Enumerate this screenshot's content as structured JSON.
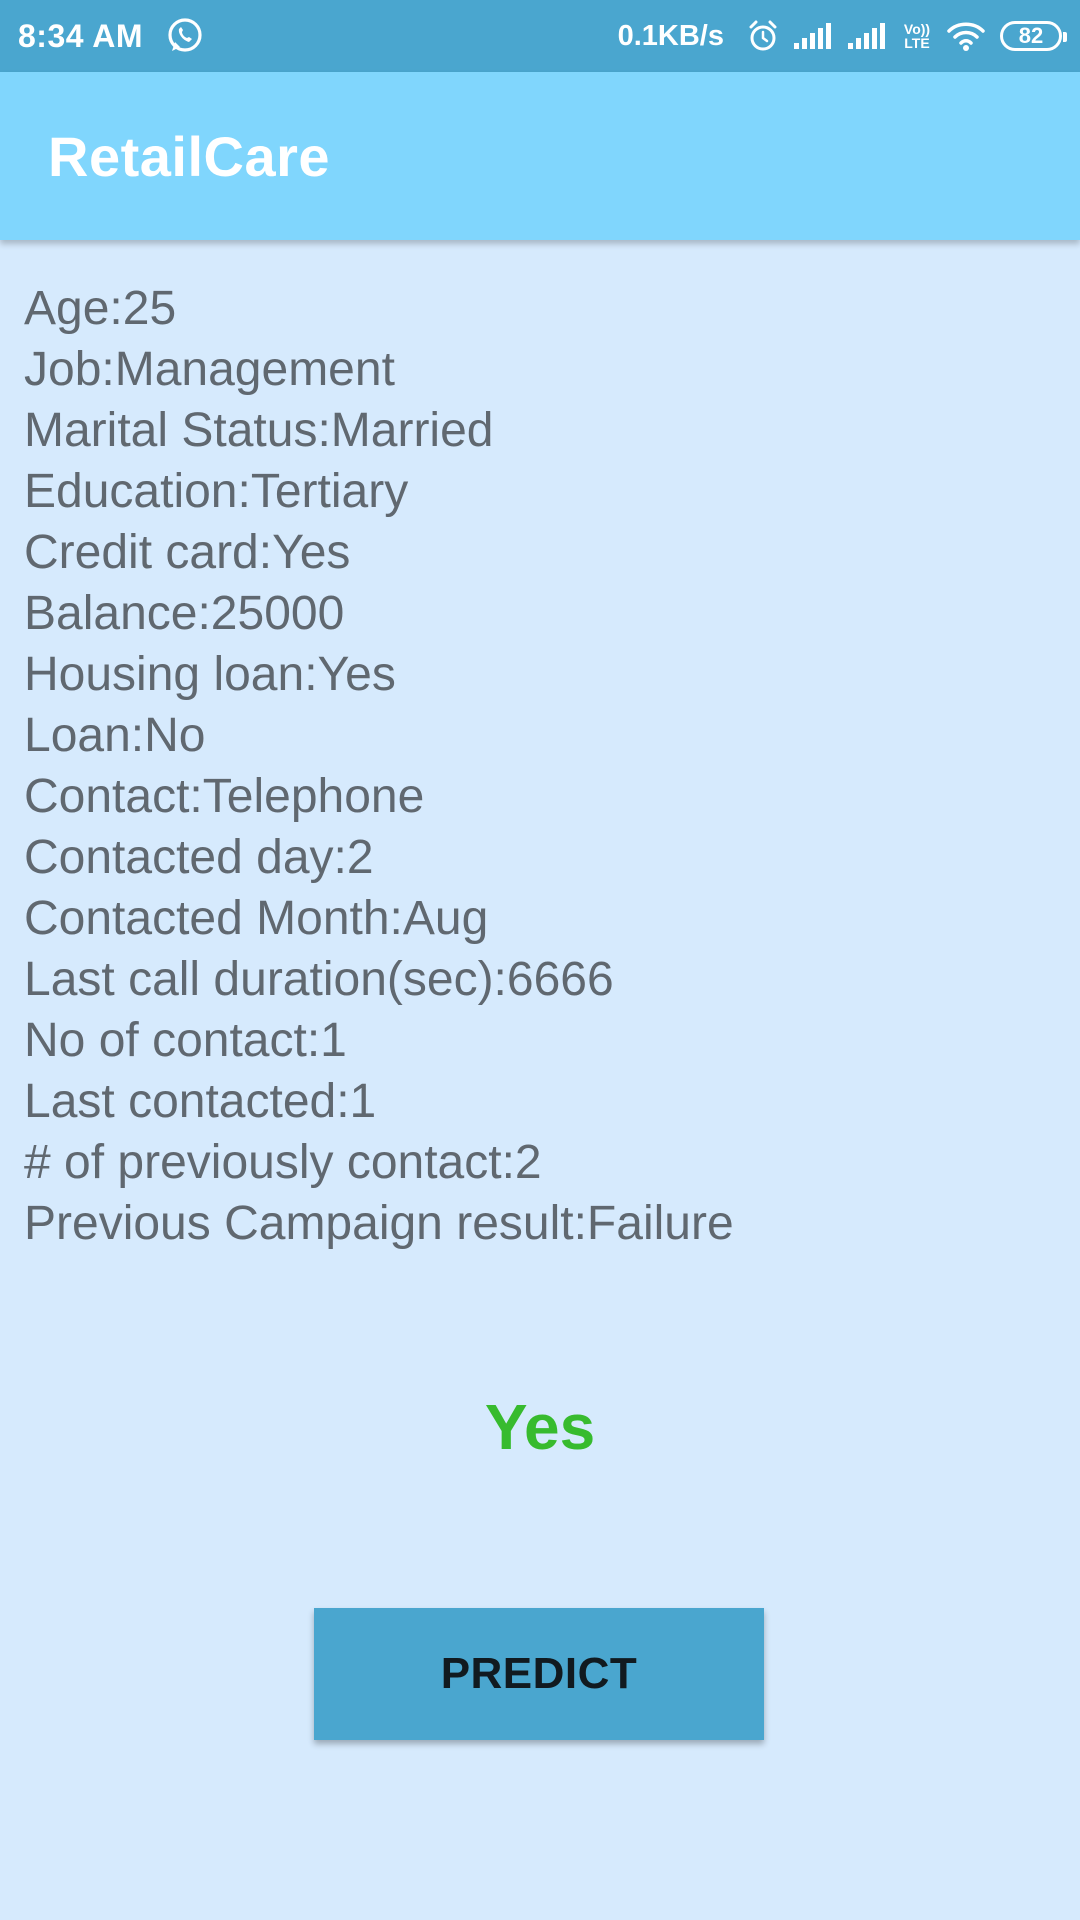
{
  "status_bar": {
    "time": "8:34 AM",
    "net_speed": "0.1KB/s",
    "volte_top": "Vo))",
    "volte_bottom": "LTE",
    "battery": "82",
    "icons": [
      "whatsapp-icon",
      "alarm-icon",
      "signal-icon",
      "signal-icon",
      "volte-icon",
      "wifi-icon",
      "battery-icon"
    ]
  },
  "app_bar": {
    "title": "RetailCare"
  },
  "details": [
    "Age:25",
    "Job:Management",
    "Marital Status:Married",
    "Education:Tertiary",
    "Credit card:Yes",
    "Balance:25000",
    "Housing loan:Yes",
    "Loan:No",
    "Contact:Telephone",
    "Contacted day:2",
    "Contacted Month:Aug",
    "Last call duration(sec):6666",
    "No of contact:1",
    "Last contacted:1",
    "# of previously contact:2",
    "Previous Campaign result:Failure"
  ],
  "result": {
    "text": "Yes",
    "color": "#37bb2e"
  },
  "predict_button": {
    "label": "PREDICT"
  },
  "colors": {
    "status_bar": "#4aa6cf",
    "app_bar": "#80d6fd",
    "background": "#d6eafd",
    "text": "#606870",
    "button": "#4aa6cf"
  }
}
